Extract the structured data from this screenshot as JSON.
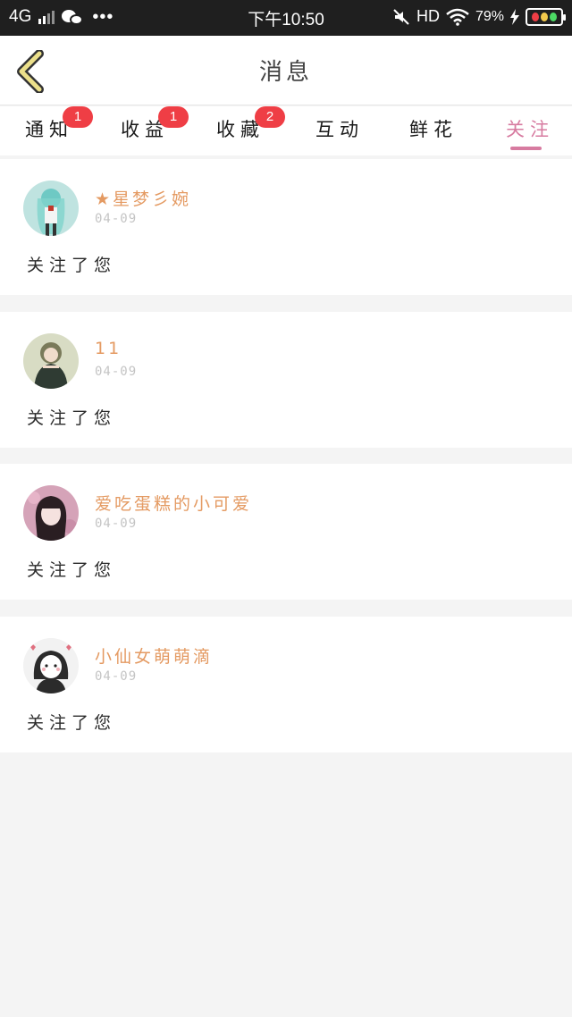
{
  "statusbar": {
    "network": "4G",
    "dots": "•••",
    "time": "下午10:50",
    "hd": "HD",
    "battery": "79%"
  },
  "header": {
    "title": "消息"
  },
  "tabs": [
    {
      "label": "通知",
      "badge": "1"
    },
    {
      "label": "收益",
      "badge": "1"
    },
    {
      "label": "收藏",
      "badge": "2"
    },
    {
      "label": "互动",
      "badge": ""
    },
    {
      "label": "鲜花",
      "badge": ""
    },
    {
      "label": "关注",
      "badge": ""
    }
  ],
  "notifications": [
    {
      "name": "★星梦彡婉",
      "date": "04-09",
      "message": "关注了您"
    },
    {
      "name": "11",
      "date": "04-09",
      "message": "关注了您"
    },
    {
      "name": "爱吃蛋糕的小可爱",
      "date": "04-09",
      "message": "关注了您"
    },
    {
      "name": "小仙女萌萌滴",
      "date": "04-09",
      "message": "关注了您"
    }
  ],
  "colors": {
    "accent": "#d77ba0",
    "username": "#e49a62",
    "badge": "#ef3e45",
    "back_arrow": "#ece08a"
  }
}
